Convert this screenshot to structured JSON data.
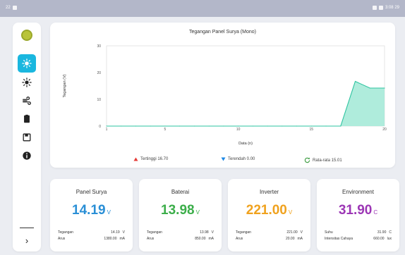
{
  "statusbar": {
    "left_text": "22",
    "right_text": "3:08 29"
  },
  "sidebar": {
    "items": [
      {
        "name": "sun-icon",
        "active": true
      },
      {
        "name": "sun-outline-icon",
        "active": false
      },
      {
        "name": "wind-icon",
        "active": false
      },
      {
        "name": "battery-icon",
        "active": false
      },
      {
        "name": "save-icon",
        "active": false
      },
      {
        "name": "info-icon",
        "active": false
      }
    ],
    "expand_label": "›"
  },
  "chart": {
    "title": "Tegangan Panel Surya (Mono)",
    "legend": [
      {
        "label": "Tertinggi 16.70",
        "marker": "triangle-up",
        "color": "#e53935"
      },
      {
        "label": "Terendah 0.00",
        "marker": "triangle-down",
        "color": "#1e88e5"
      },
      {
        "label": "Rata-rata 15.01",
        "marker": "refresh",
        "color": "#43a047"
      }
    ]
  },
  "chart_data": {
    "type": "area",
    "title": "Tegangan Panel Surya (Mono)",
    "xlabel": "Data (n)",
    "ylabel": "Tegangan (V)",
    "xlim": [
      1,
      20
    ],
    "ylim": [
      0,
      30
    ],
    "xticks": [
      1,
      5,
      10,
      15,
      20
    ],
    "yticks": [
      0,
      10,
      20,
      30
    ],
    "series": [
      {
        "x": [
          1,
          2,
          3,
          4,
          5,
          6,
          7,
          8,
          9,
          10,
          11,
          12,
          13,
          14,
          15,
          16,
          17,
          18,
          19,
          20
        ],
        "y": [
          0,
          0,
          0,
          0,
          0,
          0,
          0,
          0,
          0,
          0,
          0,
          0,
          0,
          0,
          0,
          0,
          0,
          16.7,
          14.2,
          14.2
        ],
        "color": "#2ec4a0",
        "fill": "#a6ead8"
      }
    ]
  },
  "cards": [
    {
      "title": "Panel Surya",
      "value": "14.19",
      "unit": "V",
      "color": "#2a8fd6",
      "rows": [
        {
          "label": "Tegangan",
          "value": "14.19",
          "unit": "V"
        },
        {
          "label": "Arus",
          "value": "1380.00",
          "unit": "mA"
        }
      ]
    },
    {
      "title": "Baterai",
      "value": "13.98",
      "unit": "V",
      "color": "#3cae4a",
      "rows": [
        {
          "label": "Tegangan",
          "value": "13.98",
          "unit": "V"
        },
        {
          "label": "Arus",
          "value": "850.00",
          "unit": "mA"
        }
      ]
    },
    {
      "title": "Inverter",
      "value": "221.00",
      "unit": "V",
      "color": "#f0a21e",
      "rows": [
        {
          "label": "Tegangan",
          "value": "221.00",
          "unit": "V"
        },
        {
          "label": "Arus",
          "value": "20.00",
          "unit": "mA"
        }
      ]
    },
    {
      "title": "Environment",
      "value": "31.90",
      "unit": "C",
      "color": "#9c36b5",
      "rows": [
        {
          "label": "Suhu",
          "value": "31.90",
          "unit": "C"
        },
        {
          "label": "Intensitas Cahaya",
          "value": "660.00",
          "unit": "lux"
        }
      ]
    }
  ]
}
